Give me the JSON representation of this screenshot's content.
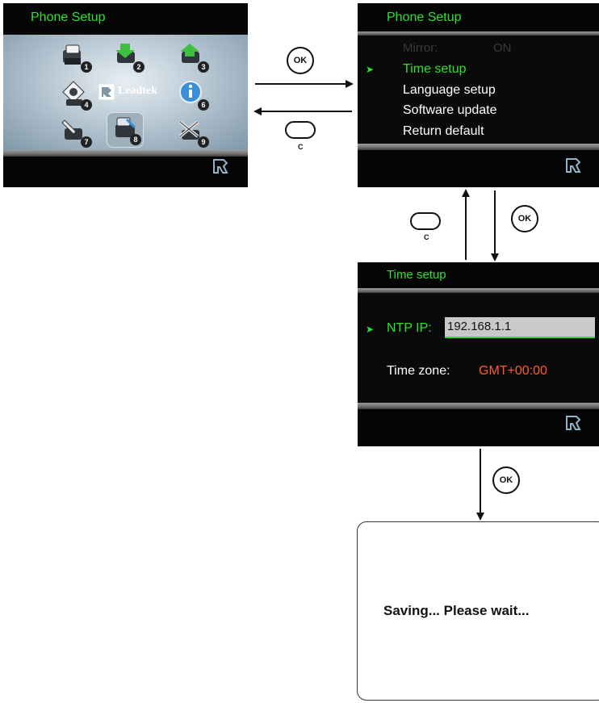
{
  "screen_main": {
    "title": "Phone Setup",
    "brand_label": "Leadtek",
    "icons": [
      {
        "name": "icon-1",
        "num": "1"
      },
      {
        "name": "icon-2",
        "num": "2"
      },
      {
        "name": "icon-3",
        "num": "3"
      },
      {
        "name": "icon-4",
        "num": "4"
      },
      {
        "name": "icon-6",
        "num": "6"
      },
      {
        "name": "icon-7",
        "num": "7"
      },
      {
        "name": "icon-8",
        "num": "8"
      },
      {
        "name": "icon-9",
        "num": "9"
      }
    ]
  },
  "screen_setup": {
    "title": "Phone Setup",
    "mirror_label": "Mirror:",
    "mirror_value": "ON",
    "items": [
      "Time setup",
      "Language setup",
      "Software update",
      "Return default"
    ],
    "selected_index": 0
  },
  "screen_time": {
    "title": "Time setup",
    "ntp_label": "NTP IP:",
    "ntp_value": "192.168.1.1",
    "tz_label": "Time zone:",
    "tz_value": "GMT+00:00"
  },
  "saving": {
    "message": "Saving... Please wait..."
  },
  "buttons": {
    "ok_label": "OK",
    "c_label": "C"
  },
  "colors": {
    "menu_green": "#2fe22f",
    "tz_orange": "#ff5a2a",
    "background": "#0a0a0a"
  }
}
